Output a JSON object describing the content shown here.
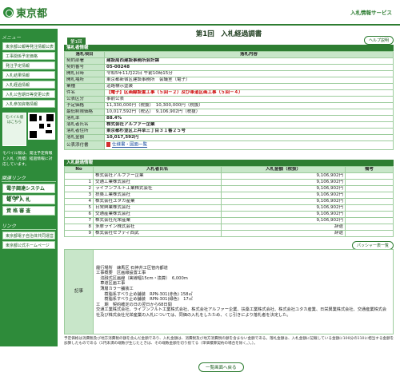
{
  "header": {
    "logo": "東京都",
    "service_title": "入札情報サービス"
  },
  "sidebar": {
    "menu_head": "メニュー",
    "items": [
      "東京都公報等発注情報公表",
      "工事関係予定価格",
      "発注予定情報",
      "入札結果情報",
      "入札経過情報",
      "入札公告期日等変更公表",
      "入札参加資格情報"
    ],
    "qr_box": "モバイル版はこちら",
    "note": "モバイル版は、発注予定情報と入札（見積）経過情報に対応しています。",
    "ext_head": "関連リンク",
    "big_items": [
      "電子調達システム(TOP)",
      "電 子 入 札",
      "資 格 審 査"
    ],
    "link_head": "リンク",
    "links": [
      "東京都電子自治体共同運営",
      "東京都公式ホームページ"
    ]
  },
  "main": {
    "title": "第1回　入札経過調書",
    "badge": "第1回",
    "help_button": "ヘルプ説明",
    "section1": "落札者情報",
    "col_item": "落札項目",
    "col_content": "落札内容",
    "rows": [
      {
        "label": "契約部署",
        "value": "建設局西建設事務所会計課"
      },
      {
        "label": "契約番号",
        "value": "05-00248"
      },
      {
        "label": "開札日時",
        "value": "令和5年11月22日 午前10時15分"
      },
      {
        "label": "開札場所",
        "value": "東京都新宿区建設事務所　会議室（電子）"
      },
      {
        "label": "業種",
        "value": "道路標示塗装"
      },
      {
        "label": "件名",
        "value": "【電子】区画線設置工事（５回－２）及び車道区画工事（５回－４）"
      },
      {
        "label": "公表区分",
        "value": "事前公表"
      },
      {
        "label": "予定価格",
        "value": "11,330,000円（税抜）　10,300,000円（税抜）"
      },
      {
        "label": "最低制限価格",
        "value": "10,017,592円（税込）　9,106,902円（税抜）"
      },
      {
        "label": "落札率",
        "value": "88.4%"
      },
      {
        "label": "落札者氏名",
        "value": "株式会社アルファー企業"
      },
      {
        "label": "落札者住所",
        "value": "東京都杉並区上井草三丁目３１番２５号"
      },
      {
        "label": "落札金額",
        "value": "10,017,592円"
      },
      {
        "label": "公表添付書",
        "value": "仕様書・図面一覧"
      }
    ],
    "section2": "入札経過情報",
    "bid_headers": [
      "No",
      "入札者氏名",
      "入札金額（税抜）",
      "備考"
    ],
    "bids": [
      {
        "no": "",
        "name": "株式会社アルファー企業",
        "amount": "9,106,902円",
        "note": ""
      },
      {
        "no": "1",
        "name": "交通工業株式会社",
        "amount": "9,106,902円",
        "note": ""
      },
      {
        "no": "2",
        "name": "ライフンフルト工業株式会社",
        "amount": "9,106,902円",
        "note": ""
      },
      {
        "no": "3",
        "name": "扶桑工業株式会社",
        "amount": "9,106,902円",
        "note": ""
      },
      {
        "no": "4",
        "name": "株式会社ユタカ産業",
        "amount": "9,106,902円",
        "note": ""
      },
      {
        "no": "5",
        "name": "日栄興業株式会社",
        "amount": "9,106,902円",
        "note": ""
      },
      {
        "no": "6",
        "name": "交通産業株式会社",
        "amount": "9,106,902円",
        "note": ""
      },
      {
        "no": "7",
        "name": "株式会社光栄産業",
        "amount": "9,106,902円",
        "note": ""
      },
      {
        "no": "8",
        "name": "多摩ライン株式会社",
        "amount": "辞退",
        "note": ""
      },
      {
        "no": "9",
        "name": "株式会社セフティ西武",
        "amount": "辞退",
        "note": ""
      }
    ],
    "close_button": "パッシャー表一覧",
    "remarks_label": "記事",
    "remarks": "履行場所　練馬区 石神井工区管内都道\n工事概要　区画線設置工事\n　溶融式区画線（実線幅15cm・換算）　6,000m\n　車道区画工事\n　薄層カラー舗装工\n　　樹脂系すべり止め舗装　RPN-301(赤色) 158㎡\n　　樹脂系すべり止め舗装　RPN-301(緑色)　17㎡\n工　期　契約確定の日の翌日から68日間\n交通工業株式会社、ライフンフルト工業株式会社、株式会社アルファー企業、扶桑工業株式会社、株式会社ユタカ産業、日栄興業株式会社、交通産業株式会社及び株式会社光栄産業の入札については、同価の入札をしたため、くじ引きにより落札者を決定した。",
    "footnote": "予定価格は消費税及び地方消費税の額を含んだ金額であり、入札金額は、消費税及び地方消費税の額を含まない金額である。落札金額は、入札金額に記載している金額に100分の110に相当する金額を加算したものである（1円未満の端数が生じたときは、その端数金額を切り捨てる（単価積算契約の場合を除く。）。）。",
    "back_button": "一覧画面へ戻る"
  }
}
